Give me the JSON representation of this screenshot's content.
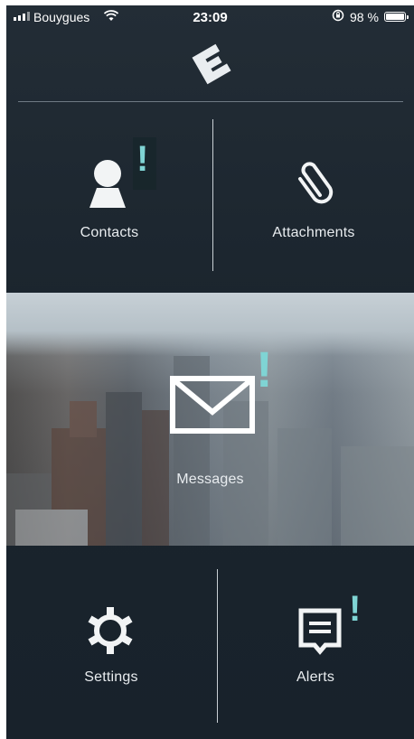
{
  "status_bar": {
    "carrier": "Bouygues",
    "time": "23:09",
    "battery_percent": "98 %",
    "icons": [
      "signal-icon",
      "wifi-icon",
      "rotation-lock-icon",
      "battery-icon"
    ]
  },
  "header": {
    "logo": "E"
  },
  "tiles": {
    "contacts": {
      "label": "Contacts",
      "icon": "person-icon",
      "alert": "!"
    },
    "attachments": {
      "label": "Attachments",
      "icon": "paperclip-icon"
    },
    "messages": {
      "label": "Messages",
      "icon": "envelope-icon",
      "alert": "!"
    },
    "settings": {
      "label": "Settings",
      "icon": "gear-icon"
    },
    "alerts": {
      "label": "Alerts",
      "icon": "speech-bubble-icon",
      "alert": "!"
    }
  },
  "colors": {
    "background": "#1e2831",
    "accent": "#7fd4d4",
    "text": "#ffffff"
  }
}
